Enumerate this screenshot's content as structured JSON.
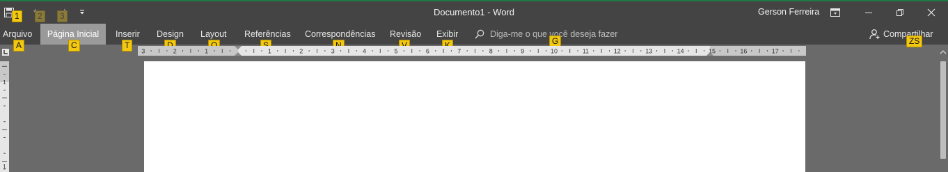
{
  "window": {
    "title": "Documento1  -  Word",
    "user": "Gerson Ferreira"
  },
  "keytips": {
    "save": "1",
    "undo": "2",
    "redo": "3",
    "arquivo": "A",
    "pagina_inicial": "C",
    "inserir": "T",
    "design": "D",
    "layout": "Q",
    "referencias": "S",
    "correspondencias": "N",
    "revisao": "V",
    "exibir": "K",
    "tellme": "G",
    "share": "ZS"
  },
  "tabs": [
    {
      "label": "Arquivo"
    },
    {
      "label": "Página Inicial",
      "active": true
    },
    {
      "label": "Inserir"
    },
    {
      "label": "Design"
    },
    {
      "label": "Layout"
    },
    {
      "label": "Referências"
    },
    {
      "label": "Correspondências"
    },
    {
      "label": "Revisão"
    },
    {
      "label": "Exibir"
    }
  ],
  "tellme": {
    "placeholder": "Diga-me o que você deseja fazer"
  },
  "share": {
    "label": "Compartilhar"
  },
  "ruler": {
    "horizontal_labels": [
      "3",
      "2",
      "1",
      "1",
      "2",
      "3",
      "4",
      "5",
      "6",
      "7",
      "8",
      "9",
      "10",
      "11",
      "12",
      "13",
      "14",
      "15",
      "16",
      "17"
    ],
    "vertical_labels": [
      "1",
      "1"
    ]
  },
  "icons": {
    "save": "save-icon",
    "undo": "undo-icon",
    "redo": "redo-icon",
    "customize": "customize-qat-icon",
    "ribbon_display": "ribbon-display-options-icon",
    "minimize": "minimize-icon",
    "restore": "restore-icon",
    "close": "close-icon",
    "search": "search-icon",
    "share": "share-person-icon",
    "tab_stop": "tab-selector-icon",
    "scroll_up": "scroll-up-arrow-icon"
  },
  "colors": {
    "title_background": "#444444",
    "accent": "#1e7a45",
    "active_tab": "#9a9a9a",
    "keytip": "#f2c811",
    "workspace": "#6a6a6a"
  }
}
